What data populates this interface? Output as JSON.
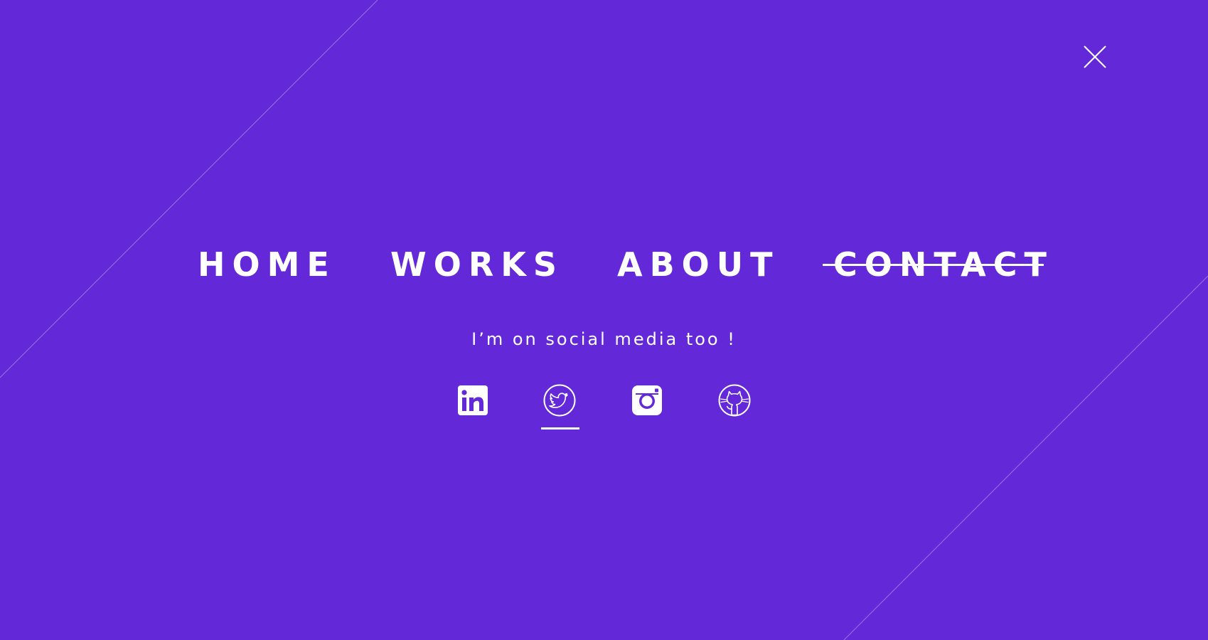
{
  "theme": {
    "background": "#6328d8",
    "foreground": "#ffffff"
  },
  "close_button": {
    "icon": "close-icon"
  },
  "nav": {
    "items": [
      {
        "label": "HOME",
        "state": "default"
      },
      {
        "label": "WORKS",
        "state": "default"
      },
      {
        "label": "ABOUT",
        "state": "default"
      },
      {
        "label": "CONTACT",
        "state": "current"
      }
    ]
  },
  "social": {
    "heading": "I’m on social media too !",
    "links": [
      {
        "icon": "linkedin-icon",
        "active": false
      },
      {
        "icon": "twitter-icon",
        "active": true
      },
      {
        "icon": "instagram-icon",
        "active": false
      },
      {
        "icon": "github-icon",
        "active": false
      }
    ]
  }
}
